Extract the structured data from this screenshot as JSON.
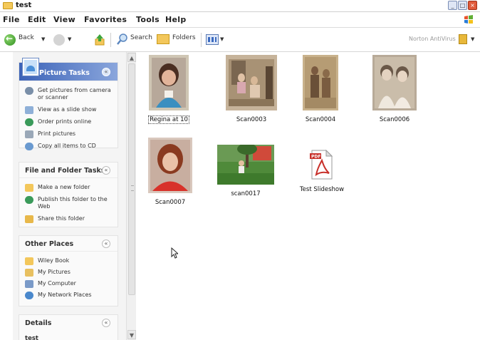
{
  "window": {
    "title": "test"
  },
  "menu": {
    "file": "File",
    "edit": "Edit",
    "view": "View",
    "favorites": "Favorites",
    "tools": "Tools",
    "help": "Help"
  },
  "toolbar": {
    "back": "Back",
    "search": "Search",
    "folders": "Folders",
    "norton": "Norton AntiVirus"
  },
  "panels": {
    "picture_tasks": {
      "title": "Picture Tasks",
      "items": [
        {
          "label": "Get pictures from camera or scanner",
          "icon": "camera-icon"
        },
        {
          "label": "View as a slide show",
          "icon": "slideshow-icon"
        },
        {
          "label": "Order prints online",
          "icon": "globe-icon"
        },
        {
          "label": "Print pictures",
          "icon": "printer-icon"
        },
        {
          "label": "Copy all items to CD",
          "icon": "cd-icon"
        }
      ]
    },
    "file_folder_tasks": {
      "title": "File and Folder Tasks",
      "items": [
        {
          "label": "Make a new folder",
          "icon": "new-folder-icon"
        },
        {
          "label": "Publish this folder to the Web",
          "icon": "globe-icon"
        },
        {
          "label": "Share this folder",
          "icon": "share-folder-icon"
        }
      ]
    },
    "other_places": {
      "title": "Other Places",
      "items": [
        {
          "label": "Wiley Book",
          "icon": "folder-icon"
        },
        {
          "label": "My Pictures",
          "icon": "my-pictures-icon"
        },
        {
          "label": "My Computer",
          "icon": "computer-icon"
        },
        {
          "label": "My Network Places",
          "icon": "network-icon"
        }
      ]
    },
    "details": {
      "title": "Details",
      "name": "test"
    }
  },
  "files": [
    {
      "name": "Regina at 10",
      "type": "photo",
      "selected": true
    },
    {
      "name": "Scan0003",
      "type": "photo",
      "selected": false
    },
    {
      "name": "Scan0004",
      "type": "photo",
      "selected": false
    },
    {
      "name": "Scan0006",
      "type": "photo",
      "selected": false
    },
    {
      "name": "Scan0007",
      "type": "photo",
      "selected": false
    },
    {
      "name": "scan0017",
      "type": "photo",
      "selected": false
    },
    {
      "name": "Test Slideshow",
      "type": "pdf",
      "selected": false
    }
  ],
  "colors": {
    "panel_header": "#3c63b8",
    "pdf_red": "#c8302a"
  }
}
